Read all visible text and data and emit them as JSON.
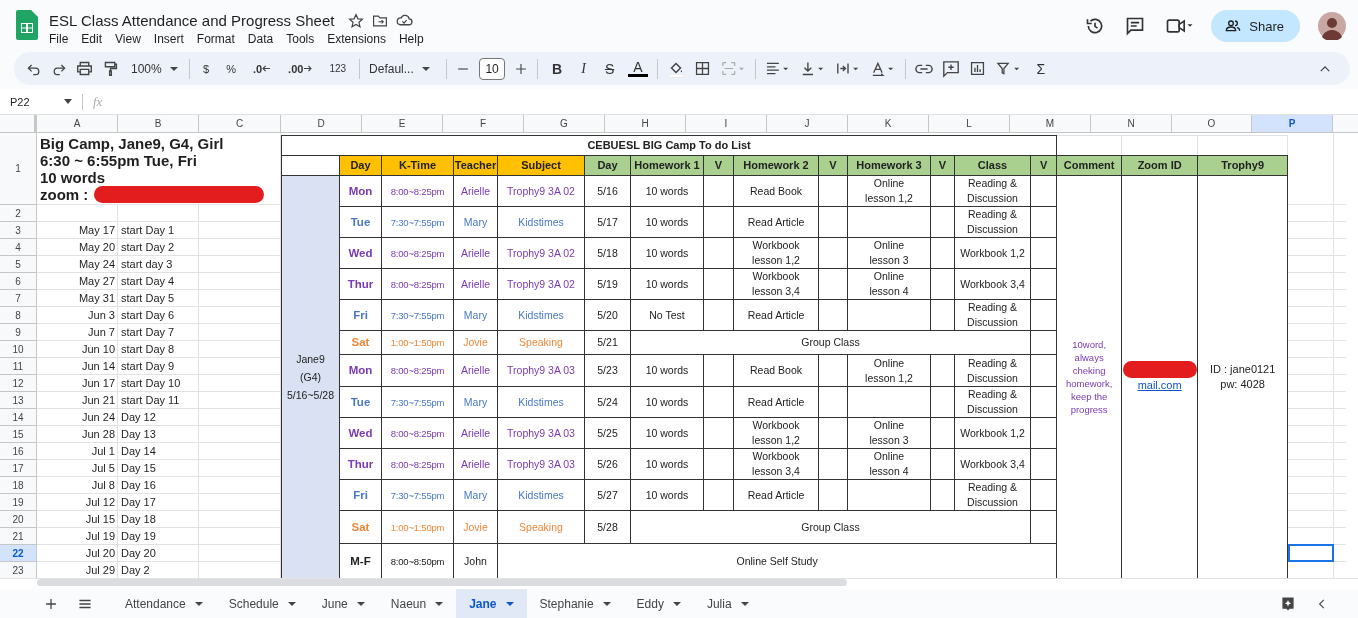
{
  "document": {
    "title": "ESL Class Attendance and Progress Sheet",
    "menu": [
      "File",
      "Edit",
      "View",
      "Insert",
      "Format",
      "Data",
      "Tools",
      "Extensions",
      "Help"
    ],
    "share_label": "Share"
  },
  "toolbar": {
    "zoom": "100%",
    "currency": "$",
    "percent": "%",
    "decimal_less": ".0",
    "decimal_more": ".00",
    "number_format": "123",
    "font": "Defaul...",
    "font_size": "10",
    "bold": "B",
    "italic": "I",
    "strikethrough": "S",
    "text_color": "A",
    "functions": "Σ"
  },
  "formula_bar": {
    "cell_ref": "P22",
    "fx_label": "fx"
  },
  "columns": [
    {
      "label": "A",
      "selected": false
    },
    {
      "label": "B",
      "selected": false
    },
    {
      "label": "C",
      "selected": false
    },
    {
      "label": "D",
      "selected": false
    },
    {
      "label": "E",
      "selected": false
    },
    {
      "label": "F",
      "selected": false
    },
    {
      "label": "G",
      "selected": false
    },
    {
      "label": "H",
      "selected": false
    },
    {
      "label": "I",
      "selected": false
    },
    {
      "label": "J",
      "selected": false
    },
    {
      "label": "K",
      "selected": false
    },
    {
      "label": "L",
      "selected": false
    },
    {
      "label": "M",
      "selected": false
    },
    {
      "label": "N",
      "selected": false
    },
    {
      "label": "O",
      "selected": false
    },
    {
      "label": "P",
      "selected": true
    }
  ],
  "row_headers": [
    {
      "label": "1",
      "selected": false
    },
    {
      "label": "2",
      "selected": false
    },
    {
      "label": "3",
      "selected": false
    },
    {
      "label": "4",
      "selected": false
    },
    {
      "label": "5",
      "selected": false
    },
    {
      "label": "6",
      "selected": false
    },
    {
      "label": "7",
      "selected": false
    },
    {
      "label": "8",
      "selected": false
    },
    {
      "label": "9",
      "selected": false
    },
    {
      "label": "10",
      "selected": false
    },
    {
      "label": "11",
      "selected": false
    },
    {
      "label": "12",
      "selected": false
    },
    {
      "label": "13",
      "selected": false
    },
    {
      "label": "14",
      "selected": false
    },
    {
      "label": "15",
      "selected": false
    },
    {
      "label": "16",
      "selected": false
    },
    {
      "label": "17",
      "selected": false
    },
    {
      "label": "18",
      "selected": false
    },
    {
      "label": "19",
      "selected": false
    },
    {
      "label": "20",
      "selected": false
    },
    {
      "label": "21",
      "selected": false
    },
    {
      "label": "22",
      "selected": true
    },
    {
      "label": "23",
      "selected": false
    }
  ],
  "info_lines": [
    "Big Camp, Jane9, G4, Girl",
    "6:30 ~ 6:55pm Tue, Fri",
    "10 words"
  ],
  "zoom_label": "zoom :",
  "schedule": [
    {
      "date": "May 17",
      "label": "start Day 1"
    },
    {
      "date": "May 20",
      "label": "start Day 2"
    },
    {
      "date": "May 24",
      "label": "start day 3"
    },
    {
      "date": "May 27",
      "label": "start Day 4"
    },
    {
      "date": "May 31",
      "label": "start Day 5"
    },
    {
      "date": "Jun 3",
      "label": "start Day 6"
    },
    {
      "date": "Jun 7",
      "label": "start Day 7"
    },
    {
      "date": "Jun 10",
      "label": "start Day 8"
    },
    {
      "date": "Jun 14",
      "label": "start Day 9"
    },
    {
      "date": "Jun 17",
      "label": "start Day 10"
    },
    {
      "date": "Jun 21",
      "label": "start Day 11"
    },
    {
      "date": "Jun 24",
      "label": "Day 12"
    },
    {
      "date": "Jun 28",
      "label": "Day 13"
    },
    {
      "date": "Jul 1",
      "label": "Day 14"
    },
    {
      "date": "Jul 5",
      "label": "Day 15"
    },
    {
      "date": "Jul 8",
      "label": "Day 16"
    },
    {
      "date": "Jul 12",
      "label": "Day 17"
    },
    {
      "date": "Jul 15",
      "label": "Day 18"
    },
    {
      "date": "Jul 19",
      "label": "Day 19"
    },
    {
      "date": "Jul 20",
      "label": "Day 20"
    },
    {
      "date": "Jul 29",
      "label": "Day 2"
    }
  ],
  "table": {
    "title": "CEBUESL BIG Camp To do List",
    "headers": [
      {
        "label": "Day",
        "color": "#ffc000"
      },
      {
        "label": "K-Time",
        "color": "#ffc000"
      },
      {
        "label": "Teacher",
        "color": "#ffc000"
      },
      {
        "label": "Subject",
        "color": "#ffc000"
      },
      {
        "label": "Day",
        "color": "#a9d08e"
      },
      {
        "label": "Homework 1",
        "color": "#a9d08e"
      },
      {
        "label": "V",
        "color": "#a9d08e"
      },
      {
        "label": "Homework 2",
        "color": "#a9d08e"
      },
      {
        "label": "V",
        "color": "#a9d08e"
      },
      {
        "label": "Homework 3",
        "color": "#a9d08e"
      },
      {
        "label": "V",
        "color": "#a9d08e"
      },
      {
        "label": "Class",
        "color": "#a9d08e"
      },
      {
        "label": "V",
        "color": "#a9d08e"
      },
      {
        "label": "Comment",
        "color": "#a9d08e"
      },
      {
        "label": "Zoom ID",
        "color": "#a9d08e"
      },
      {
        "label": "Trophy9",
        "color": "#a9d08e"
      }
    ],
    "group_label": "Jane9\n(G4)\n5/16~5/28",
    "comment": "10word, always cheking homework, keep the progress",
    "zoom_link": "mail.com",
    "trophy": "ID : jane0121\npw: 4028",
    "rows": [
      {
        "kind": "lesson",
        "day": "Mon",
        "time": "8:00~8:25pm",
        "teacher": "Arielle",
        "subject": "Trophy9 3A 02",
        "date": "5/16",
        "homework_1": "10 words",
        "homework_2": "Read Book",
        "homework_3": "Online\nlesson 1,2",
        "class": "Reading &\nDiscussion",
        "color": "#7b3ab5"
      },
      {
        "kind": "lesson",
        "day": "Tue",
        "time": "7:30~7:55pm",
        "teacher": "Mary",
        "subject": "Kidstimes",
        "date": "5/17",
        "homework_1": "10 words",
        "homework_2": "Read Article",
        "class": "Reading &\nDiscussion",
        "color": "#4a78c8"
      },
      {
        "kind": "lesson",
        "day": "Wed",
        "time": "8:00~8:25pm",
        "teacher": "Arielle",
        "subject": "Trophy9 3A 02",
        "date": "5/18",
        "homework_1": "10 words",
        "homework_2": "Workbook\nlesson 1,2",
        "homework_3": "Online\nlesson 3",
        "class": "Workbook 1,2",
        "color": "#7b3ab5"
      },
      {
        "kind": "lesson",
        "day": "Thur",
        "time": "8:00~8:25pm",
        "teacher": "Arielle",
        "subject": "Trophy9 3A 02",
        "date": "5/19",
        "homework_1": "10 words",
        "homework_2": "Workbook\nlesson 3,4",
        "homework_3": "Online\nlesson 4",
        "class": "Workbook 3,4",
        "color": "#7b3ab5"
      },
      {
        "kind": "lesson",
        "day": "Fri",
        "time": "7:30~7:55pm",
        "teacher": "Mary",
        "subject": "Kidstimes",
        "date": "5/20",
        "homework_1": "No Test",
        "homework_2": "Read Article",
        "class": "Reading &\nDiscussion",
        "color": "#4a78c8"
      },
      {
        "kind": "group",
        "day": "Sat",
        "time": "1:00~1:50pm",
        "teacher": "Jovie",
        "subject": "Speaking",
        "date": "5/21",
        "activity": "Group Class",
        "color": "#f0883a"
      },
      {
        "kind": "lesson",
        "day": "Mon",
        "time": "8:00~8:25pm",
        "teacher": "Arielle",
        "subject": "Trophy9 3A 03",
        "date": "5/23",
        "homework_1": "10 words",
        "homework_2": "Read Book",
        "homework_3": "Online\nlesson 1,2",
        "class": "Reading &\nDiscussion",
        "color": "#7b3ab5"
      },
      {
        "kind": "lesson",
        "day": "Tue",
        "time": "7:30~7:55pm",
        "teacher": "Mary",
        "subject": "Kidstimes",
        "date": "5/24",
        "homework_1": "10 words",
        "homework_2": "Read Article",
        "class": "Reading &\nDiscussion",
        "color": "#4a78c8"
      },
      {
        "kind": "lesson",
        "day": "Wed",
        "time": "8:00~8:25pm",
        "teacher": "Arielle",
        "subject": "Trophy9 3A 03",
        "date": "5/25",
        "homework_1": "10 words",
        "homework_2": "Workbook\nlesson 1,2",
        "homework_3": "Online\nlesson 3",
        "class": "Workbook 1,2",
        "color": "#7b3ab5"
      },
      {
        "kind": "lesson",
        "day": "Thur",
        "time": "8:00~8:25pm",
        "teacher": "Arielle",
        "subject": "Trophy9 3A 03",
        "date": "5/26",
        "homework_1": "10 words",
        "homework_2": "Workbook\nlesson 3,4",
        "homework_3": "Online\nlesson 4",
        "class": "Workbook 3,4",
        "color": "#7b3ab5"
      },
      {
        "kind": "lesson",
        "day": "Fri",
        "time": "7:30~7:55pm",
        "teacher": "Mary",
        "subject": "Kidstimes",
        "date": "5/27",
        "homework_1": "10 words",
        "homework_2": "Read Article",
        "class": "Reading &\nDiscussion",
        "color": "#4a78c8"
      },
      {
        "kind": "group",
        "day": "Sat",
        "time": "1:00~1:50pm",
        "teacher": "Jovie",
        "subject": "Speaking",
        "date": "5/28",
        "activity": "Group Class",
        "color": "#f0883a"
      },
      {
        "kind": "self_study",
        "day": "M-F",
        "time": "8:00~8:50pm",
        "teacher": "John",
        "activity": "Online Self Study",
        "color": "#222222"
      }
    ]
  },
  "sheet_tabs": [
    {
      "label": "Attendance",
      "selected": false
    },
    {
      "label": "Schedule",
      "selected": false
    },
    {
      "label": "June",
      "selected": false
    },
    {
      "label": "Naeun",
      "selected": false
    },
    {
      "label": "Jane",
      "selected": true
    },
    {
      "label": "Stephanie",
      "selected": false
    },
    {
      "label": "Eddy",
      "selected": false
    },
    {
      "label": "Julia",
      "selected": false
    }
  ]
}
